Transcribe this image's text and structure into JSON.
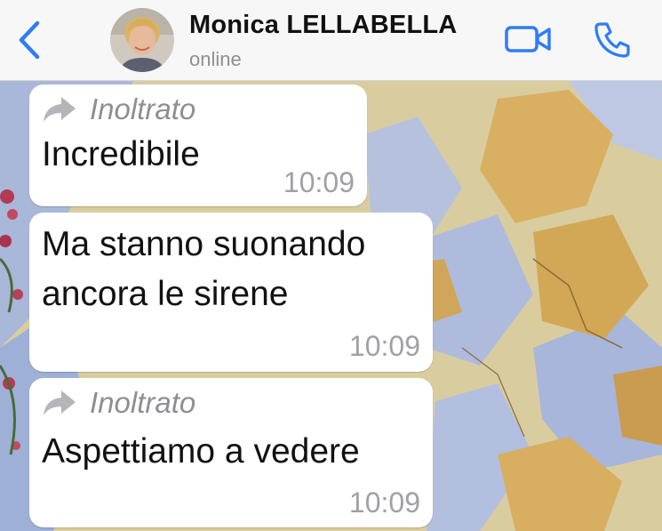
{
  "header": {
    "back_icon": "chevron-left-icon",
    "contact_name": "Monica LELLABELLA",
    "status": "online",
    "video_icon": "video-camera-icon",
    "call_icon": "phone-icon",
    "accent_color": "#2f7cf6"
  },
  "messages": [
    {
      "forwarded_label": "Inoltrato",
      "text_lines": [
        "Incredibile"
      ],
      "time": "10:09"
    },
    {
      "forwarded_label": "",
      "text_lines": [
        "Ma stanno suonando",
        "ancora le sirene"
      ],
      "time": "10:09"
    },
    {
      "forwarded_label": "Inoltrato",
      "text_lines": [
        "Aspettiamo a vedere"
      ],
      "time": "10:09"
    }
  ],
  "colors": {
    "header_bg": "#f7f7f7",
    "bubble_bg": "#ffffff",
    "secondary_text": "#8e8e93"
  }
}
